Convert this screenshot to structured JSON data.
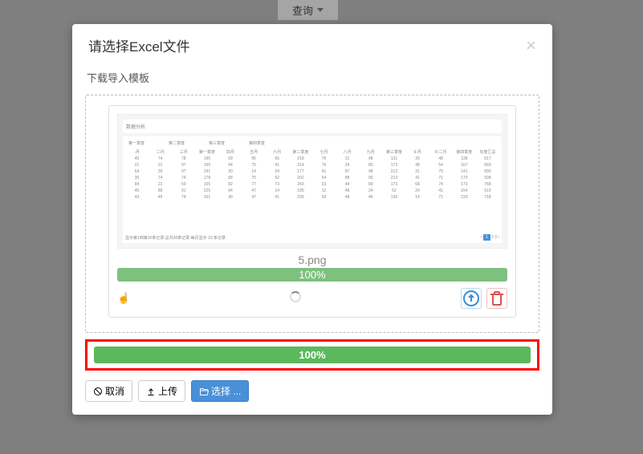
{
  "top": {
    "query": "查询"
  },
  "modal": {
    "title": "请选择Excel文件",
    "template_link": "下载导入模板",
    "file": {
      "name": "5.png",
      "progress_text": "100%"
    },
    "main_progress_text": "100%",
    "preview": {
      "title": "数据分析",
      "group_headers": [
        "第一季度",
        "第二季度",
        "第三季度",
        "第四季度"
      ],
      "col_headers": [
        "-月",
        "二月",
        "三月",
        "第一季度",
        "四月",
        "五月",
        "六月",
        "第二季度",
        "七月",
        "八月",
        "九月",
        "第三季度",
        "9-月",
        "8-二月",
        "第四季度",
        "年度汇总"
      ],
      "rows": [
        [
          "45",
          "74",
          "78",
          "195",
          "69",
          "95",
          "65",
          "218",
          "76",
          "31",
          "48",
          "131",
          "39",
          "48",
          "138",
          "617"
        ],
        [
          "21",
          "31",
          "97",
          "150",
          "94",
          "75",
          "41",
          "214",
          "76",
          "24",
          "80",
          "173",
          "48",
          "54",
          "167",
          "669"
        ],
        [
          "64",
          "30",
          "97",
          "191",
          "30",
          "14",
          "54",
          "177",
          "41",
          "87",
          "48",
          "212",
          "31",
          "79",
          "141",
          "690"
        ],
        [
          "30",
          "74",
          "74",
          "178",
          "68",
          "75",
          "52",
          "202",
          "54",
          "88",
          "90",
          "213",
          "41",
          "71",
          "170",
          "598"
        ],
        [
          "84",
          "21",
          "50",
          "155",
          "82",
          "77",
          "73",
          "243",
          "23",
          "44",
          "89",
          "173",
          "68",
          "74",
          "173",
          "768"
        ],
        [
          "45",
          "89",
          "91",
          "225",
          "94",
          "47",
          "14",
          "195",
          "12",
          "48",
          "24",
          "62",
          "24",
          "41",
          "154",
          "519"
        ],
        [
          "43",
          "45",
          "74",
          "161",
          "49",
          "47",
          "41",
          "239",
          "59",
          "48",
          "46",
          "139",
          "14",
          "71",
          "233",
          "718"
        ]
      ],
      "footer_left": "显示第1到第10条记录,总共30条记录 每页显示 10 条记录",
      "footer_pages": [
        "‹",
        "1",
        "2",
        "3",
        "›"
      ]
    },
    "buttons": {
      "cancel": "取消",
      "upload": "上传",
      "select": "选择 ..."
    }
  }
}
